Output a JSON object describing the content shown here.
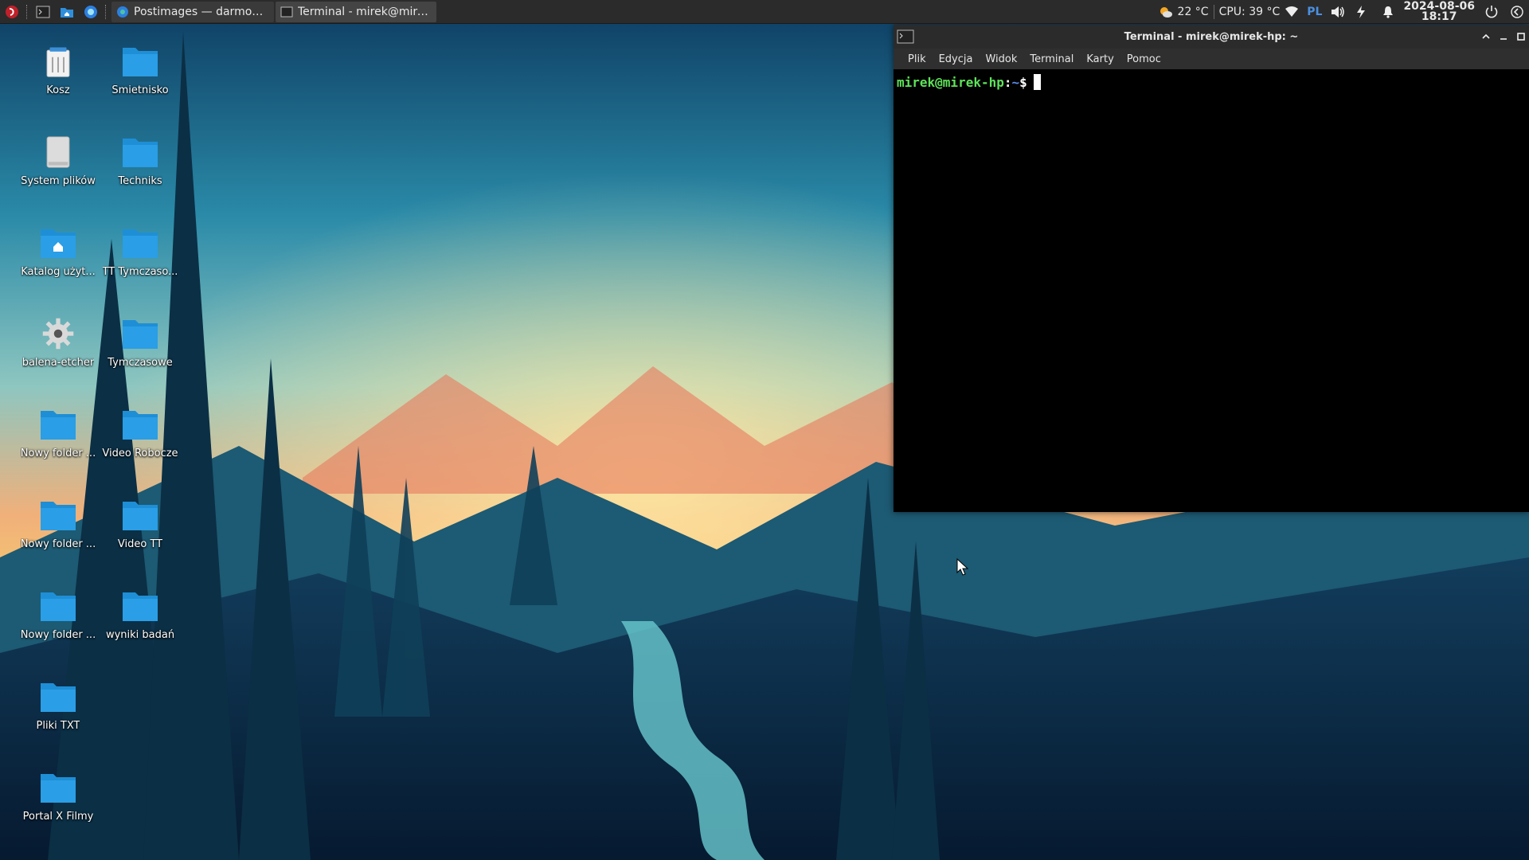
{
  "taskbar": {
    "tasks": [
      {
        "title": "Postimages — darmowy h..."
      },
      {
        "title": "Terminal - mirek@mirek-h..."
      }
    ],
    "tray": {
      "weather": "22 °C",
      "cpu": "CPU: 39 °C",
      "keyboard_layout": "PL",
      "date": "2024-08-06",
      "time": "18:17"
    }
  },
  "desktop": {
    "icons": [
      {
        "label": "Kosz",
        "icon": "trash-icon"
      },
      {
        "label": "Śmietnisko",
        "icon": "folder-icon"
      },
      {
        "label": "System plików",
        "icon": "drive-icon"
      },
      {
        "label": "Techniks",
        "icon": "folder-icon"
      },
      {
        "label": "Katalog użyt...",
        "icon": "home-folder-icon"
      },
      {
        "label": "TT Tymczaso...",
        "icon": "folder-icon"
      },
      {
        "label": "balena-etcher",
        "icon": "gear-icon"
      },
      {
        "label": "Tymczasowe",
        "icon": "folder-icon"
      },
      {
        "label": "Nowy folder ...",
        "icon": "folder-icon"
      },
      {
        "label": "Video Robocze",
        "icon": "folder-icon"
      },
      {
        "label": "Nowy folder ...",
        "icon": "folder-icon"
      },
      {
        "label": "Video TT",
        "icon": "folder-icon"
      },
      {
        "label": "Nowy folder ...",
        "icon": "folder-icon"
      },
      {
        "label": "wyniki badań",
        "icon": "folder-icon"
      },
      {
        "label": "Pliki TXT",
        "icon": "folder-icon"
      },
      {
        "label": "Portal X Filmy",
        "icon": "folder-icon"
      }
    ]
  },
  "terminal": {
    "title": "Terminal - mirek@mirek-hp: ~",
    "menu": [
      "Plik",
      "Edycja",
      "Widok",
      "Terminal",
      "Karty",
      "Pomoc"
    ],
    "prompt_user": "mirek@mirek-hp",
    "prompt_sep": ":",
    "prompt_path": "~",
    "prompt_symbol": "$"
  },
  "colors": {
    "folder": "#1e8fd6",
    "taskbar": "#2b2b2b",
    "prompt_user": "#5ee25a",
    "prompt_path": "#5b8ae6",
    "layout_indicator": "#4a90e2"
  }
}
